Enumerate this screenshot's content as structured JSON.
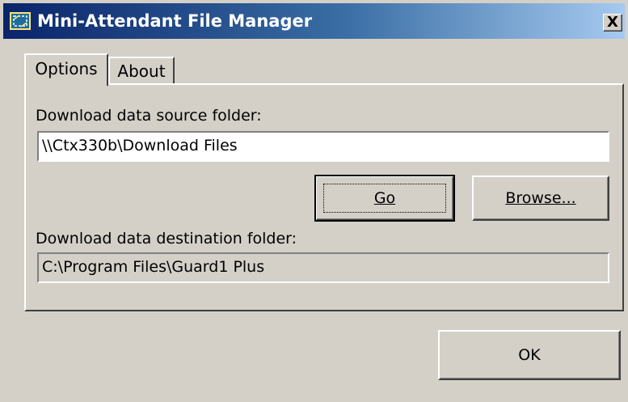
{
  "window": {
    "title": "Mini-Attendant File Manager",
    "close_glyph": "X",
    "icon": "app-folder-icon",
    "titlebar_colors": [
      "#0a246a",
      "#a6caf0"
    ]
  },
  "tabs": [
    {
      "label": "Options",
      "selected": true
    },
    {
      "label": "About",
      "selected": false
    }
  ],
  "options": {
    "source_label": "Download data source folder:",
    "source_value": "\\\\Ctx330b\\Download Files",
    "go_label": "Go",
    "browse_label": "Browse...",
    "destination_label": "Download data destination folder:",
    "destination_value": "C:\\Program Files\\Guard1 Plus"
  },
  "footer": {
    "ok_label": "OK"
  }
}
